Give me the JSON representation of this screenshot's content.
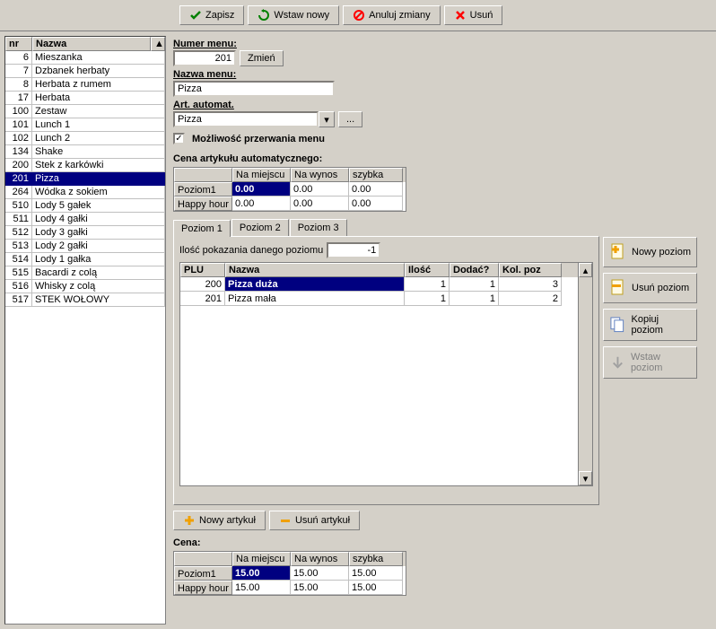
{
  "toolbar": {
    "save": "Zapisz",
    "insert_new": "Wstaw nowy",
    "cancel": "Anuluj zmiany",
    "delete": "Usuń"
  },
  "left_list": {
    "col_nr": "nr",
    "col_name": "Nazwa",
    "rows": [
      {
        "nr": "6",
        "name": "Mieszanka"
      },
      {
        "nr": "7",
        "name": "Dzbanek herbaty"
      },
      {
        "nr": "8",
        "name": "Herbata z rumem"
      },
      {
        "nr": "17",
        "name": "Herbata"
      },
      {
        "nr": "100",
        "name": "Zestaw"
      },
      {
        "nr": "101",
        "name": "Lunch 1"
      },
      {
        "nr": "102",
        "name": "Lunch 2"
      },
      {
        "nr": "134",
        "name": "Shake"
      },
      {
        "nr": "200",
        "name": "Stek z karkówki"
      },
      {
        "nr": "201",
        "name": "Pizza"
      },
      {
        "nr": "264",
        "name": "Wódka z sokiem"
      },
      {
        "nr": "510",
        "name": "Lody 5 gałek"
      },
      {
        "nr": "511",
        "name": "Lody 4 gałki"
      },
      {
        "nr": "512",
        "name": "Lody 3 gałki"
      },
      {
        "nr": "513",
        "name": "Lody 2 gałki"
      },
      {
        "nr": "514",
        "name": "Lody 1 gałka"
      },
      {
        "nr": "515",
        "name": "Bacardi z colą"
      },
      {
        "nr": "516",
        "name": "Whisky z colą"
      },
      {
        "nr": "517",
        "name": "STEK WOŁOWY"
      }
    ],
    "selected_nr": "201"
  },
  "form": {
    "numer_menu_label": "Numer menu:",
    "numer_menu_value": "201",
    "zmien": "Zmień",
    "nazwa_menu_label": "Nazwa menu:",
    "nazwa_menu_value": "Pizza",
    "art_automat_label": "Art. automat.",
    "art_automat_value": "Pizza",
    "dots": "...",
    "mozliwosc_label": "Możliwość przerwania menu",
    "mozliwosc_checked": true
  },
  "price_auto": {
    "header": "Cena artykułu automatycznego:",
    "cols": {
      "na_miejscu": "Na miejscu",
      "na_wynos": "Na wynos",
      "szybka": "szybka"
    },
    "rows": [
      {
        "label": "Poziom1",
        "na_miejscu": "0.00",
        "na_wynos": "0.00",
        "szybka": "0.00"
      },
      {
        "label": "Happy hour",
        "na_miejscu": "0.00",
        "na_wynos": "0.00",
        "szybka": "0.00"
      }
    ]
  },
  "tabs": {
    "t1": "Poziom 1",
    "t2": "Poziom 2",
    "t3": "Poziom 3",
    "active": 0
  },
  "tabcontent": {
    "ilosc_label": "Ilość pokazania danego poziomu",
    "ilosc_value": "-1",
    "cols": {
      "plu": "PLU",
      "nazwa": "Nazwa",
      "ilosc": "Ilość",
      "dodac": "Dodać?",
      "kol": "Kol. poz"
    },
    "rows": [
      {
        "plu": "200",
        "nazwa": "Pizza duża",
        "ilosc": "1",
        "dodac": "1",
        "kol": "3",
        "sel": true
      },
      {
        "plu": "201",
        "nazwa": "Pizza mała",
        "ilosc": "1",
        "dodac": "1",
        "kol": "2",
        "sel": false
      }
    ]
  },
  "sidebtns": {
    "nowy": "Nowy poziom",
    "usun": "Usuń poziom",
    "kopiuj": "Kopiuj poziom",
    "wstaw": "Wstaw poziom"
  },
  "artbtns": {
    "nowy": "Nowy artykuł",
    "usun": "Usuń artykuł"
  },
  "cena": {
    "header": "Cena:",
    "cols": {
      "na_miejscu": "Na miejscu",
      "na_wynos": "Na wynos",
      "szybka": "szybka"
    },
    "rows": [
      {
        "label": "Poziom1",
        "na_miejscu": "15.00",
        "na_wynos": "15.00",
        "szybka": "15.00"
      },
      {
        "label": "Happy hour",
        "na_miejscu": "15.00",
        "na_wynos": "15.00",
        "szybka": "15.00"
      }
    ]
  }
}
